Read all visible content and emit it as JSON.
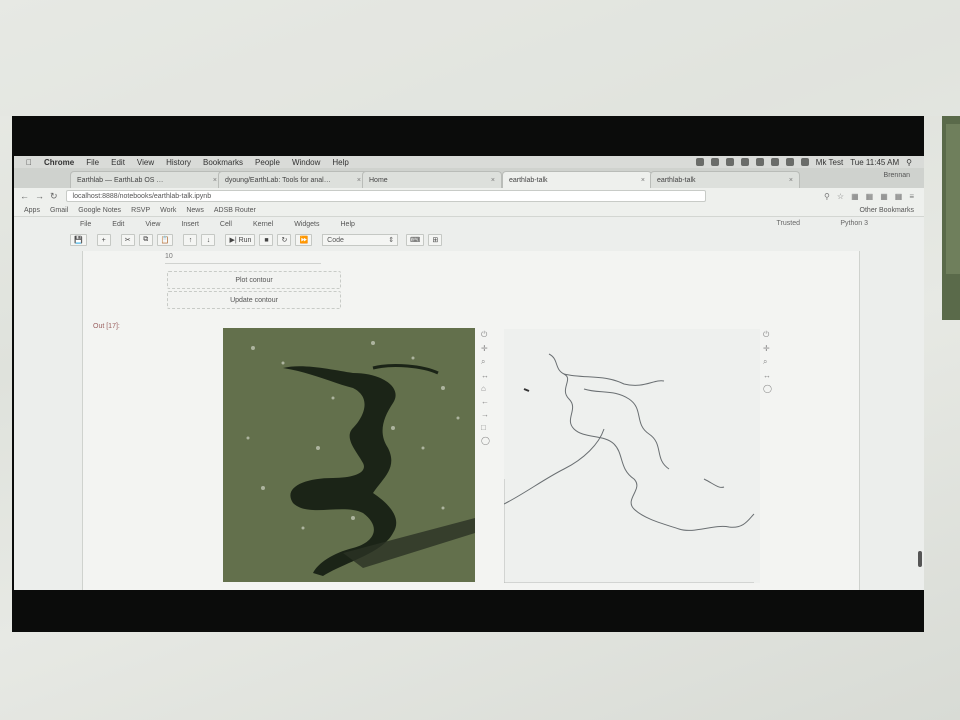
{
  "browser": {
    "menubar": {
      "app": "Chrome",
      "items": [
        "File",
        "Edit",
        "View",
        "History",
        "Bookmarks",
        "People",
        "Window",
        "Help"
      ],
      "clock": "Tue 11:45 AM",
      "user": "Mk Test"
    },
    "tabs": [
      {
        "label": "Earthlab — EarthLab OS …",
        "active": false
      },
      {
        "label": "dyoung/EarthLab: Tools for anal…",
        "active": false
      },
      {
        "label": "Home",
        "active": false
      },
      {
        "label": "earthlab-talk",
        "active": true
      },
      {
        "label": "earthlab-talk",
        "active": false
      }
    ],
    "profile": "Brennan",
    "url": "localhost:8888/notebooks/earthlab-talk.ipynb",
    "bookmarks": [
      "Apps",
      "Gmail",
      "Google Notes",
      "RSVP",
      "Work",
      "News",
      "ADSB Router"
    ],
    "other_bookmarks": "Other Bookmarks"
  },
  "jupyter": {
    "menu": [
      "File",
      "Edit",
      "View",
      "Insert",
      "Cell",
      "Kernel",
      "Widgets",
      "Help"
    ],
    "kernel_state": "Trusted",
    "kernel_name": "Python 3",
    "toolbar": {
      "save": "💾",
      "add": "+",
      "cut": "✂",
      "copy": "⧉",
      "paste": "📋",
      "up": "↑",
      "down": "↓",
      "run": "▶| Run",
      "stop": "■",
      "restart": "↻",
      "run_all": "⏩",
      "cell_type": "Code",
      "palette": "⌨",
      "celltoolbar": "⊞"
    }
  },
  "notebook": {
    "widget_value": "10",
    "button_plot": "Plot contour",
    "button_update": "Update contour",
    "out_prompt": "Out [17]:"
  },
  "colors": {
    "image_bg": "#6a7754",
    "water": "#1b2417",
    "contour": "#6a6f72"
  }
}
